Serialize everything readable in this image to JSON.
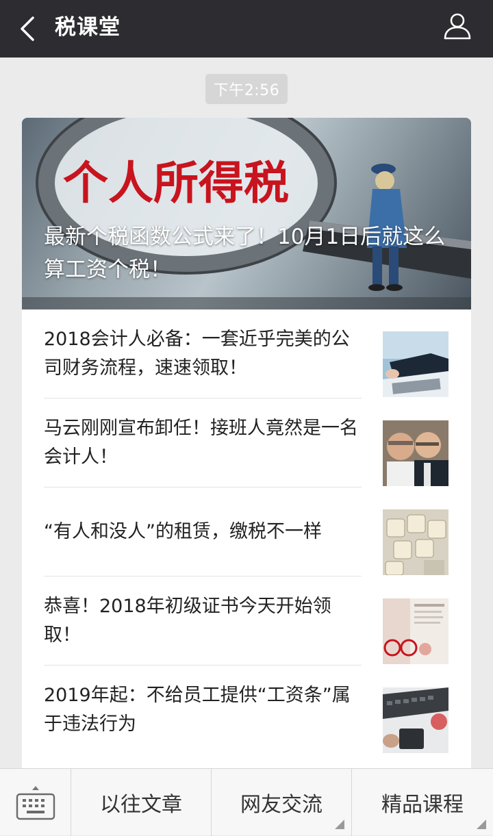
{
  "header": {
    "title": "税课堂",
    "back_icon": "chevron-left-icon",
    "profile_icon": "person-icon"
  },
  "timestamp": "下午2:56",
  "cover": {
    "image_text": "个人所得税",
    "title": "最新个税函数公式来了！10月1日后就这么算工资个税！"
  },
  "articles": [
    {
      "title": "2018会计人必备：一套近乎完美的公司财务流程，速速领取！"
    },
    {
      "title": "马云刚刚宣布卸任！接班人竟然是一名会计人！"
    },
    {
      "title": "“有人和没人”的租赁，缴税不一样"
    },
    {
      "title": "恭喜！2018年初级证书今天开始领取！"
    },
    {
      "title": "2019年起：不给员工提供“工资条”属于违法行为"
    }
  ],
  "bottom_menu": {
    "keyboard_icon": "keyboard-icon",
    "items": [
      {
        "label": "以往文章"
      },
      {
        "label": "网友交流"
      },
      {
        "label": "精品课程"
      }
    ]
  },
  "colors": {
    "topbar": "#2d2d31",
    "background": "#ebebeb",
    "cover_text_red": "#c8141e"
  }
}
